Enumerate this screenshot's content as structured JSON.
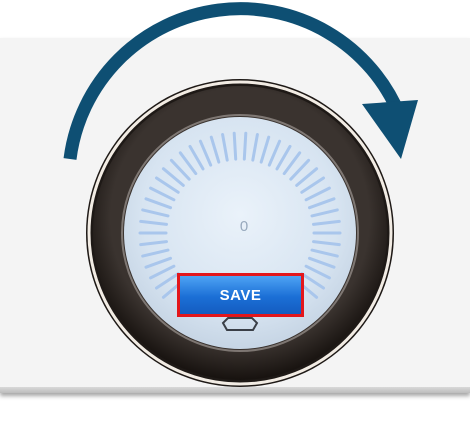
{
  "gauge": {
    "value": "0",
    "tick_count": 40,
    "face_color": "#dbe7f3",
    "tick_color": "#a9c6ec"
  },
  "save_button": {
    "label": "SAVE",
    "highlight_color": "#e3161b",
    "fill_color": "#1b6fd6"
  },
  "rotation_hint": {
    "icon": "rotate-clockwise-arrow-icon",
    "direction": "clockwise",
    "color": "#0e4f73"
  },
  "bezel": {
    "ring_color": "#2b2522",
    "highlight_color": "#f2ece4"
  }
}
